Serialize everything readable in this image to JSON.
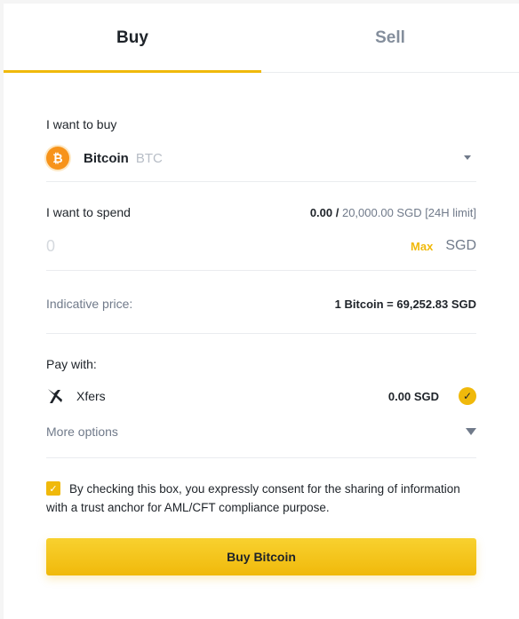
{
  "tabs": {
    "buy": "Buy",
    "sell": "Sell"
  },
  "asset": {
    "label": "I want to buy",
    "name": "Bitcoin",
    "symbol": "BTC",
    "icon": "bitcoin-icon",
    "icon_glyph": "₿"
  },
  "spend": {
    "label": "I want to spend",
    "current": "0.00",
    "separator": " / ",
    "limit": "20,000.00 SGD [24H limit]",
    "input_value": "0",
    "max_label": "Max",
    "currency": "SGD"
  },
  "price": {
    "label": "Indicative price:",
    "value": "1 Bitcoin = 69,252.83 SGD"
  },
  "payment": {
    "label": "Pay with:",
    "method_name": "Xfers",
    "method_icon": "xfers-icon",
    "balance": "0.00 SGD",
    "selected": true,
    "more_options": "More options"
  },
  "consent": {
    "checked": true,
    "text": "By checking this box, you expressly consent for the sharing of information with a trust anchor for AML/CFT compliance purpose."
  },
  "submit": {
    "label": "Buy Bitcoin"
  },
  "colors": {
    "accent": "#f0b90b",
    "text": "#1e2329",
    "muted": "#707a8a",
    "btc": "#f7931a"
  }
}
